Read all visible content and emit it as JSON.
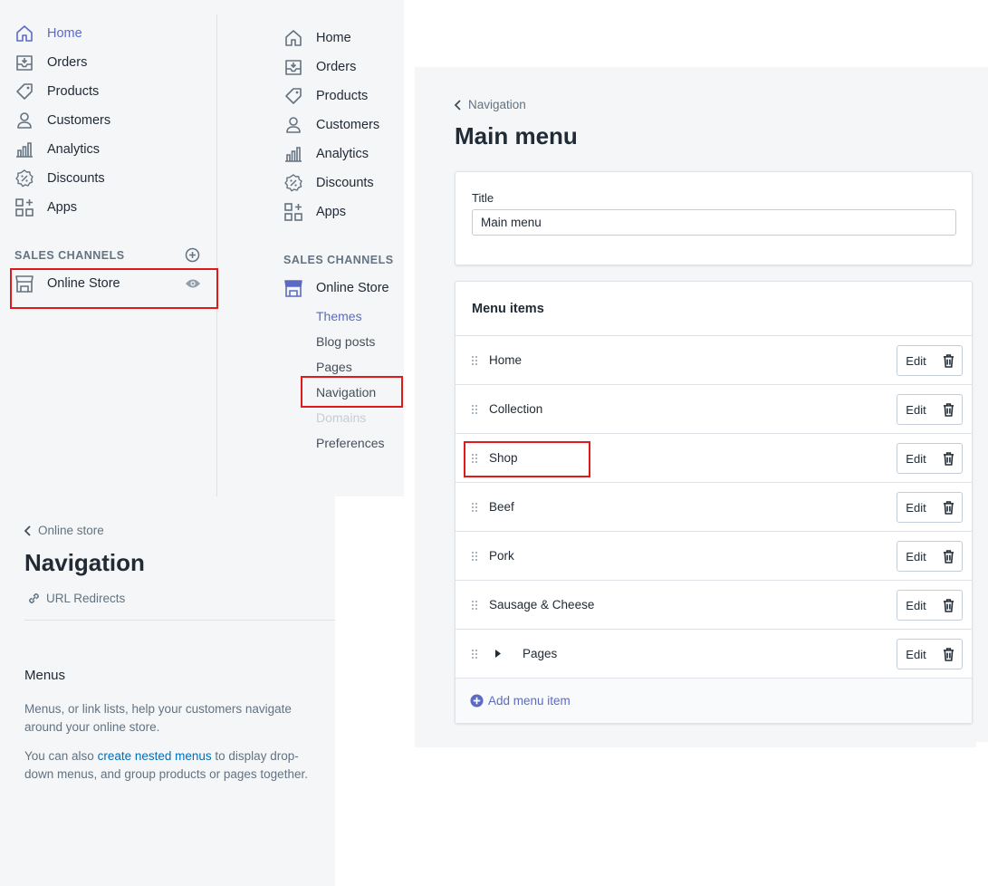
{
  "sidebar_primary": {
    "items": [
      {
        "label": "Home",
        "icon": "home-icon"
      },
      {
        "label": "Orders",
        "icon": "orders-icon"
      },
      {
        "label": "Products",
        "icon": "tag-icon"
      },
      {
        "label": "Customers",
        "icon": "user-icon"
      },
      {
        "label": "Analytics",
        "icon": "bar-chart-icon"
      },
      {
        "label": "Discounts",
        "icon": "discount-icon"
      },
      {
        "label": "Apps",
        "icon": "apps-icon"
      }
    ],
    "sales_channels_label": "SALES CHANNELS",
    "online_store_label": "Online Store"
  },
  "sidebar_secondary": {
    "items": [
      {
        "label": "Home"
      },
      {
        "label": "Orders"
      },
      {
        "label": "Products"
      },
      {
        "label": "Customers"
      },
      {
        "label": "Analytics"
      },
      {
        "label": "Discounts"
      },
      {
        "label": "Apps"
      }
    ],
    "sales_channels_label": "SALES CHANNELS",
    "online_store_label": "Online Store",
    "sub_items": [
      {
        "label": "Themes"
      },
      {
        "label": "Blog posts"
      },
      {
        "label": "Pages"
      },
      {
        "label": "Navigation"
      },
      {
        "label": "Domains"
      },
      {
        "label": "Preferences"
      }
    ]
  },
  "navigation_page": {
    "back_label": "Online store",
    "title": "Navigation",
    "url_redirects_label": "URL Redirects",
    "menus_heading": "Menus",
    "menus_desc": "Menus, or link lists, help your customers navigate around your online store.",
    "nested_prefix": "You can also ",
    "nested_link": "create nested menus",
    "nested_suffix": " to display drop-down menus, and group products or pages together."
  },
  "main_menu_page": {
    "back_label": "Navigation",
    "title": "Main menu",
    "title_field_label": "Title",
    "title_field_value": "Main menu",
    "menu_items_heading": "Menu items",
    "edit_label": "Edit",
    "rows": [
      {
        "label": "Home"
      },
      {
        "label": "Collection"
      },
      {
        "label": "Shop"
      },
      {
        "label": "Beef"
      },
      {
        "label": "Pork"
      },
      {
        "label": "Sausage & Cheese"
      },
      {
        "label": "Pages"
      }
    ],
    "add_menu_item_label": "Add menu item"
  },
  "colors": {
    "accent": "#5c6ac4",
    "link": "#006fbb",
    "highlight_border": "#e01a1a",
    "panel_bg": "#f4f6f8"
  }
}
